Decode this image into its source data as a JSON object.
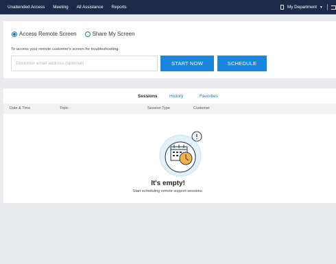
{
  "nav": {
    "items": [
      "Unattended Access",
      "Meeting",
      "All Assistance",
      "Reports"
    ],
    "department": "My Department",
    "department_icon": "device-icon",
    "folder_icon": "folder-icon"
  },
  "remote": {
    "options": [
      "Access Remote Screen",
      "Share My Screen"
    ],
    "selected": "Access Remote Screen",
    "description": "To access your remote customer's screen for troubleshooting.",
    "email_placeholder": "Customer email address (optional)",
    "start_label": "START NOW",
    "schedule_label": "SCHEDULE"
  },
  "sessions": {
    "tabs": [
      "Sessions",
      "History",
      "Favorites"
    ],
    "active_tab": "Sessions",
    "columns": [
      "Date & Time",
      "Topic",
      "Session Type",
      "Customer"
    ],
    "rows": [],
    "empty_title": "It's empty!",
    "empty_subtitle": "Start scheduling remote support sessions.",
    "empty_icon": "calendar-clock-icon"
  },
  "colors": {
    "nav_bg": "#1c2b4a",
    "accent": "#1b85dc",
    "page_bg": "#e9ebef"
  }
}
